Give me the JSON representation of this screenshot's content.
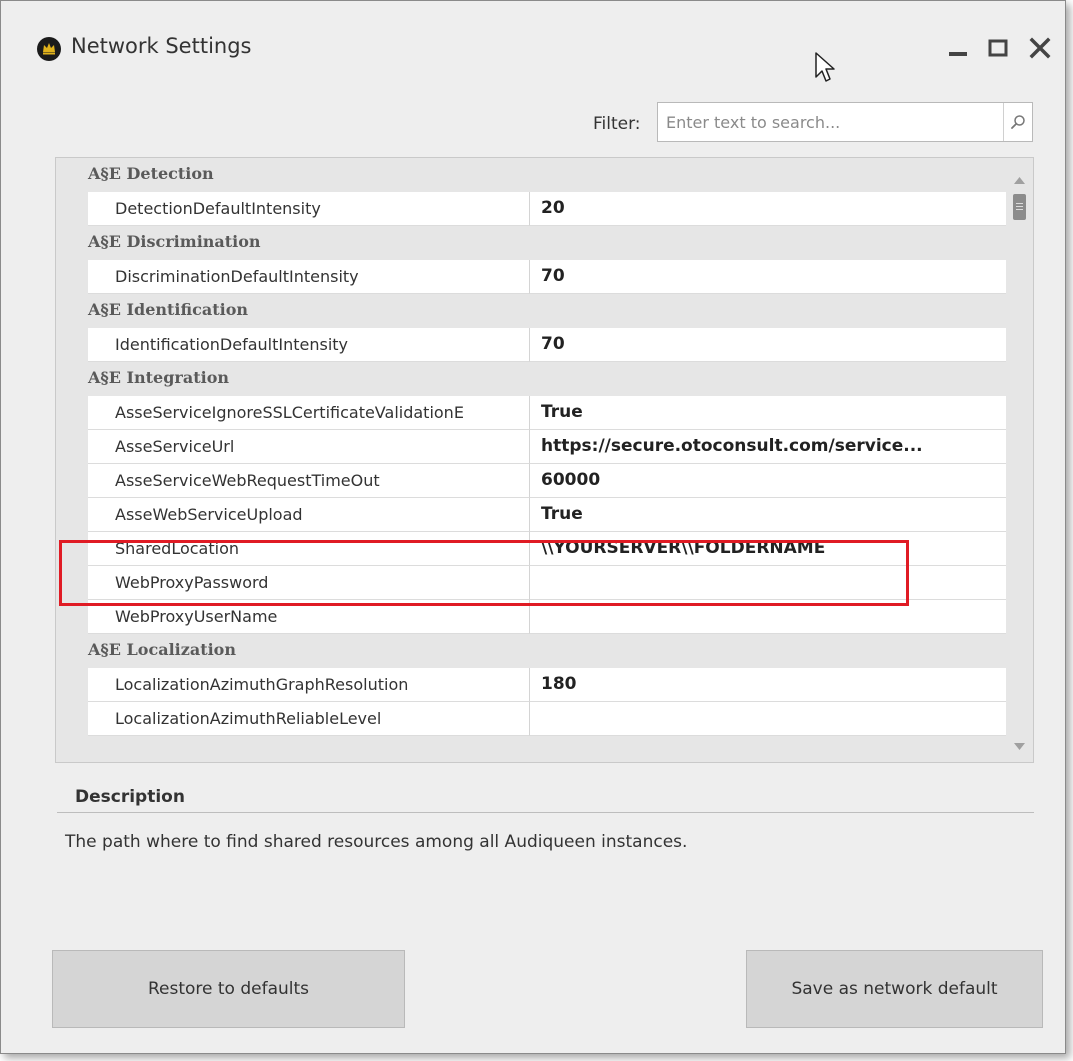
{
  "window": {
    "title": "Network Settings"
  },
  "filter": {
    "label": "Filter:",
    "placeholder": "Enter text to search..."
  },
  "grid": {
    "sections": [
      {
        "category": "A§E Detection",
        "properties": [
          {
            "name": "DetectionDefaultIntensity",
            "value": "20"
          }
        ]
      },
      {
        "category": "A§E Discrimination",
        "properties": [
          {
            "name": "DiscriminationDefaultIntensity",
            "value": "70"
          }
        ]
      },
      {
        "category": "A§E Identification",
        "properties": [
          {
            "name": "IdentificationDefaultIntensity",
            "value": "70"
          }
        ]
      },
      {
        "category": "A§E Integration",
        "properties": [
          {
            "name": "AsseServiceIgnoreSSLCertificateValidationE",
            "value": "True"
          },
          {
            "name": "AsseServiceUrl",
            "value": "https://secure.otoconsult.com/service..."
          },
          {
            "name": "AsseServiceWebRequestTimeOut",
            "value": "60000"
          },
          {
            "name": "AsseWebServiceUpload",
            "value": "True"
          },
          {
            "name": "SharedLocation",
            "value": "\\\\YOURSERVER\\\\FOLDERNAME"
          },
          {
            "name": "WebProxyPassword",
            "value": ""
          },
          {
            "name": "WebProxyUserName",
            "value": ""
          }
        ]
      },
      {
        "category": "A§E Localization",
        "properties": [
          {
            "name": "LocalizationAzimuthGraphResolution",
            "value": "180"
          },
          {
            "name": "LocalizationAzimuthReliableLevel",
            "value": ""
          }
        ]
      }
    ]
  },
  "description": {
    "title": "Description",
    "text": "The path where to find shared resources among all Audiqueen instances."
  },
  "buttons": {
    "restore": "Restore to defaults",
    "save": "Save as network default"
  },
  "colors": {
    "highlight": "#e01b24",
    "window_bg": "#eeeeee",
    "category_bg": "#e6e6e6"
  }
}
